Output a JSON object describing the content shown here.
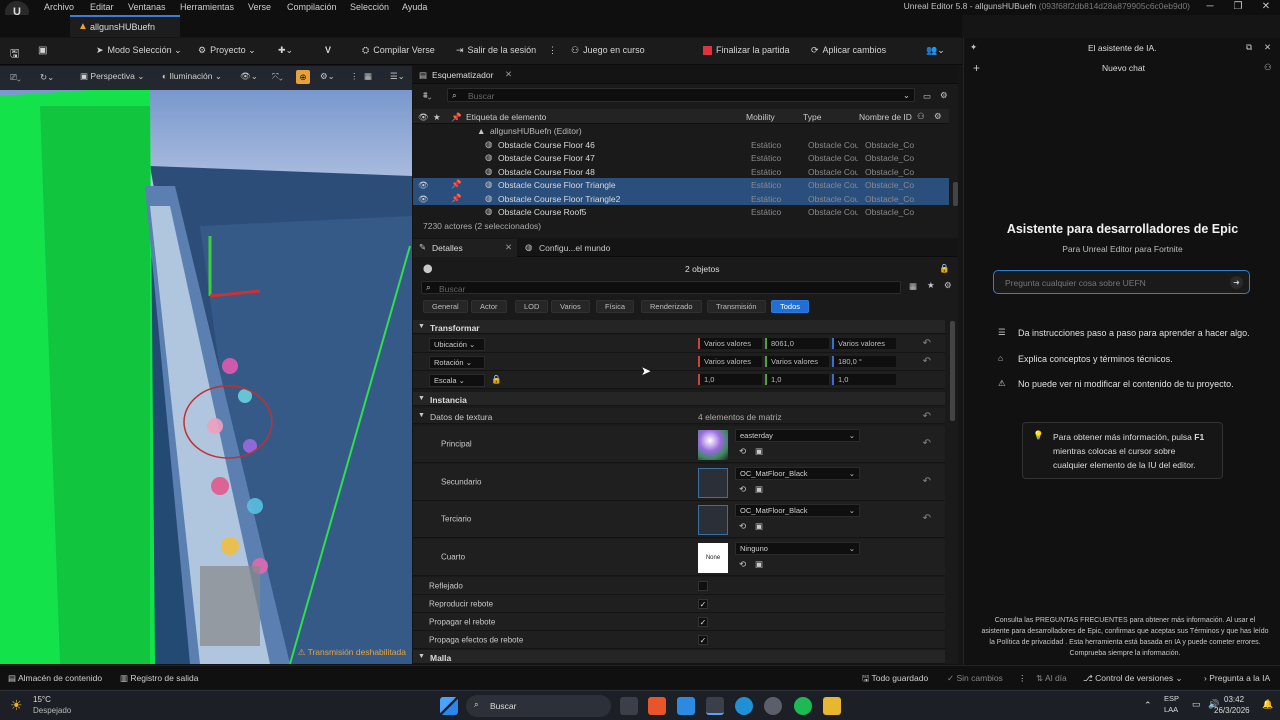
{
  "menubar": {
    "items": [
      "Archivo",
      "Editar",
      "Ventanas",
      "Herramientas",
      "Verse",
      "Compilación",
      "Selección",
      "Ayuda"
    ],
    "window_title": "Unreal Editor 5.8 - allgunsHUBuefn",
    "window_id": "(093f68f2db814d28a879905c6c0eb9d0)"
  },
  "project_tab": "allgunsHUBuefn",
  "toolbar": {
    "mode": "Modo Selección",
    "project": "Proyecto",
    "compile": "Compilar Verse",
    "logout": "Salir de la sesión",
    "game": "Juego en curso",
    "end": "Finalizar la partida",
    "apply": "Aplicar cambios"
  },
  "viewport": {
    "perspective": "Perspectiva",
    "lighting": "Iluminación",
    "warning": "Transmisión deshabilitada"
  },
  "outliner": {
    "title": "Esquematizador",
    "search_placeholder": "Buscar",
    "col_label": "Etiqueta de elemento",
    "col_mobility": "Mobility",
    "col_type": "Type",
    "col_id": "Nombre de ID",
    "root": "allgunsHUBuefn (Editor)",
    "rows": [
      {
        "name": "Obstacle Course Floor 46",
        "mobility": "Estático",
        "type": "Obstacle Cou",
        "id": "Obstacle_Co",
        "selected": false
      },
      {
        "name": "Obstacle Course Floor 47",
        "mobility": "Estático",
        "type": "Obstacle Cou",
        "id": "Obstacle_Co",
        "selected": false
      },
      {
        "name": "Obstacle Course Floor 48",
        "mobility": "Estático",
        "type": "Obstacle Cou",
        "id": "Obstacle_Co",
        "selected": false
      },
      {
        "name": "Obstacle Course Floor Triangle",
        "mobility": "Estático",
        "type": "Obstacle Cou",
        "id": "Obstacle_Co",
        "selected": true
      },
      {
        "name": "Obstacle Course Floor Triangle2",
        "mobility": "Estático",
        "type": "Obstacle Cou",
        "id": "Obstacle_Co",
        "selected": true
      },
      {
        "name": "Obstacle Course Roof5",
        "mobility": "Estático",
        "type": "Obstacle Cou",
        "id": "Obstacle_Co",
        "selected": false
      }
    ],
    "status": "7230 actores (2 seleccionados)"
  },
  "details": {
    "tab1": "Detalles",
    "tab2": "Configu...el mundo",
    "objects": "2 objetos",
    "search_placeholder": "Buscar",
    "filters": [
      "General",
      "Actor",
      "LOD",
      "Varios",
      "Física",
      "Renderizado",
      "Transmisión",
      "Todos"
    ],
    "transform_header": "Transformar",
    "location_label": "Ubicación",
    "location": [
      "Varios valores",
      "8061,0",
      "Varios valores"
    ],
    "rotation_label": "Rotación",
    "rotation": [
      "Varios valores",
      "Varios valores",
      "180,0 °"
    ],
    "scale_label": "Escala",
    "scale": [
      "1,0",
      "1,0",
      "1,0"
    ],
    "instance_header": "Instancia",
    "texture_data": "Datos de textura",
    "array_count": "4 elementos de matriz",
    "tex": [
      {
        "label": "Principal",
        "value": "easterday"
      },
      {
        "label": "Secundario",
        "value": "OC_MatFloor_Black"
      },
      {
        "label": "Terciario",
        "value": "OC_MatFloor_Black"
      },
      {
        "label": "Cuarto",
        "value": "Ninguno",
        "thumb": "None"
      }
    ],
    "bools": [
      {
        "label": "Reflejado",
        "checked": false
      },
      {
        "label": "Reproducir rebote",
        "checked": true
      },
      {
        "label": "Propagar el rebote",
        "checked": true
      },
      {
        "label": "Propaga efectos de rebote",
        "checked": true
      }
    ],
    "mesh_header": "Malla"
  },
  "ai": {
    "header": "El asistente de IA.",
    "new_chat": "Nuevo chat",
    "title": "Asistente para desarrolladores de Epic",
    "subtitle": "Para Unreal Editor para Fortnite",
    "input_placeholder": "Pregunta cualquier cosa sobre UEFN",
    "bullets": [
      "Da instrucciones paso a paso para aprender a hacer algo.",
      "Explica conceptos y términos técnicos.",
      "No puede ver ni modificar el contenido de tu proyecto."
    ],
    "tip_a": "Para obtener más información, pulsa",
    "tip_key": "F1",
    "tip_b": "mientras colocas el cursor sobre",
    "tip_c": "cualquier elemento de la IU del editor.",
    "footer": "Consulta las PREGUNTAS FRECUENTES para obtener más información. Al usar el asistente para desarrolladores de Epic, confirmas que aceptas sus Términos y que has leído la Política de privacidad . Esta herramienta está basada en IA y puede cometer errores. Comprueba siempre la información."
  },
  "statusbar": {
    "content": "Almacén de contenido",
    "log": "Registro de salida",
    "saved": "Todo guardado",
    "nochanges": "Sin cambios",
    "uptodate": "Al día",
    "vc": "Control de versiones",
    "ask": "Pregunta a la IA"
  },
  "taskbar": {
    "temp": "15°C",
    "weather": "Despejado",
    "search": "Buscar",
    "lang1": "ESP",
    "lang2": "LAA",
    "time": "03:42",
    "date": "26/3/2026"
  },
  "colors": {
    "accent": "#1f6fd6",
    "selection": "#2a4f7c",
    "end_button": "#e0333d"
  }
}
